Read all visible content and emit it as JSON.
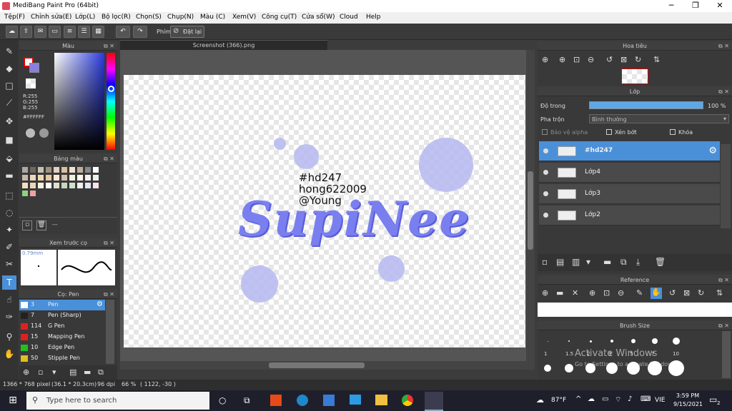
{
  "window": {
    "title": "MediBang Paint Pro (64bit)",
    "minimize": "─",
    "maximize": "❐",
    "close": "✕"
  },
  "menu": [
    "Tệp(F)",
    "Chỉnh sửa(E)",
    "Lớp(L)",
    "Bộ lọc(R)",
    "Chọn(S)",
    "Chụp(N)",
    "Màu (C)",
    "Xem(V)",
    "Công cụ(T)",
    "Cửa sổ(W)",
    "Cloud",
    "Help"
  ],
  "toolbar": {
    "key_label": "Phím",
    "reset_label": "Đặt lại"
  },
  "color_panel": {
    "title": "Màu",
    "r": "R:255",
    "g": "G:255",
    "b": "B:255",
    "hex": "#FFFFFF"
  },
  "palette_panel": {
    "title": "Bảng màu",
    "dash": "---"
  },
  "brush_preview": {
    "title": "Xem trước cọ",
    "size": "0.79mm"
  },
  "brush_panel": {
    "title": "Cọ: Pen",
    "items": [
      {
        "num": "3",
        "name": "Pen",
        "color": "#ffffff"
      },
      {
        "num": "7",
        "name": "Pen (Sharp)",
        "color": "#222222"
      },
      {
        "num": "114",
        "name": "G Pen",
        "color": "#e02020"
      },
      {
        "num": "15",
        "name": "Mapping Pen",
        "color": "#e02020"
      },
      {
        "num": "10",
        "name": "Edge Pen",
        "color": "#20c020"
      },
      {
        "num": "50",
        "name": "Stipple Pen",
        "color": "#e0c020"
      }
    ]
  },
  "document": {
    "tab": "Screenshot (366).png"
  },
  "canvas_art": {
    "line1": "#hd247",
    "line2": "hong622009",
    "line3": "@Young",
    "logo": "SupiNee"
  },
  "navigator": {
    "title": "Hoa tiêu"
  },
  "layer_panel": {
    "title": "Lớp",
    "opacity_label": "Độ trong",
    "opacity_value": "100 %",
    "blend_label": "Pha trộn",
    "blend_value": "Bình thường",
    "protect_alpha": "Bảo vệ alpha",
    "clipping": "Xén bớt",
    "lock": "Khóa",
    "layers": [
      {
        "name": "#hd247",
        "selected": true
      },
      {
        "name": "Lớp4",
        "selected": false
      },
      {
        "name": "Lớp3",
        "selected": false
      },
      {
        "name": "Lớp2",
        "selected": false
      }
    ]
  },
  "reference_panel": {
    "title": "Reference"
  },
  "brush_size_panel": {
    "title": "Brush Size",
    "labels": [
      "1",
      "1.5",
      "2",
      "3",
      "5",
      "7",
      "10"
    ],
    "watermark1": "Activate Windows",
    "watermark2": "Go to Settings to activate Windows."
  },
  "status": {
    "dims": "1366 * 768 pixel",
    "physical": "(36.1 * 20.3cm)",
    "dpi": "96 dpi",
    "zoom": "66 %",
    "coords": "( 1122, -30 )"
  },
  "taskbar": {
    "search_placeholder": "Type here to search",
    "weather": "87°F",
    "lang": "VIE",
    "time": "3:59 PM",
    "date": "9/15/2021",
    "notif": "2"
  }
}
